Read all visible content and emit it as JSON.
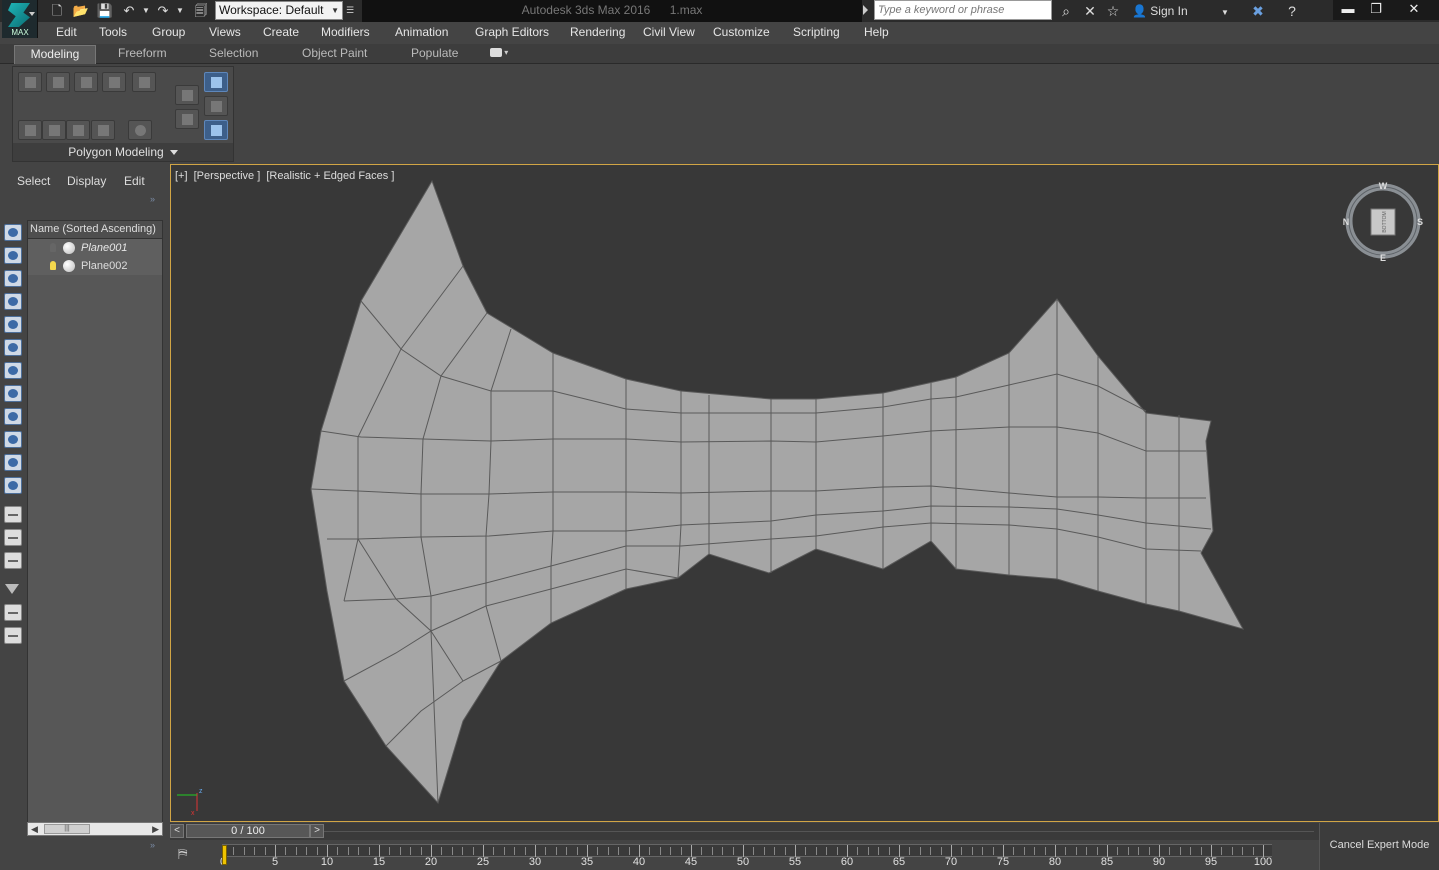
{
  "app": {
    "logo_text": "MAX",
    "workspace": "Workspace: Default",
    "title": "Autodesk 3ds Max 2016",
    "filename": "1.max",
    "search_placeholder": "Type a keyword or phrase",
    "signin": "Sign In"
  },
  "menu": [
    "Edit",
    "Tools",
    "Group",
    "Views",
    "Create",
    "Modifiers",
    "Animation",
    "Graph Editors",
    "Rendering",
    "Civil View",
    "Customize",
    "Scripting",
    "Help"
  ],
  "ribbon": {
    "tabs": [
      "Modeling",
      "Freeform",
      "Selection",
      "Object Paint",
      "Populate"
    ],
    "active_tab": "Modeling",
    "panel_label": "Polygon Modeling"
  },
  "explorer": {
    "tabs": [
      "Select",
      "Display",
      "Edit"
    ],
    "column_header": "Name (Sorted Ascending)",
    "items": [
      {
        "name": "Plane001",
        "light_on": false,
        "italic": true
      },
      {
        "name": "Plane002",
        "light_on": true,
        "italic": false
      }
    ]
  },
  "viewport": {
    "labels": [
      "[+]",
      "[Perspective ]",
      "[Realistic + Edged Faces ]"
    ],
    "viewcube_letters": [
      "W",
      "S",
      "E",
      "N"
    ],
    "viewcube_face": "BOTTOM",
    "axis_labels": [
      "z",
      "x"
    ],
    "colors": {
      "bg": "#383838",
      "mesh": "#a6a6a6",
      "edges": "#5a5a5a",
      "border": "#d1a545"
    }
  },
  "timeline": {
    "position": "0 / 100",
    "prev": "<",
    "next": ">",
    "ticks": [
      "0",
      "5",
      "10",
      "15",
      "20",
      "25",
      "30",
      "35",
      "40",
      "45",
      "50",
      "55",
      "60",
      "65",
      "70",
      "75",
      "80",
      "85",
      "90",
      "95",
      "100"
    ]
  },
  "status": {
    "expert_button": "Cancel Expert Mode"
  }
}
